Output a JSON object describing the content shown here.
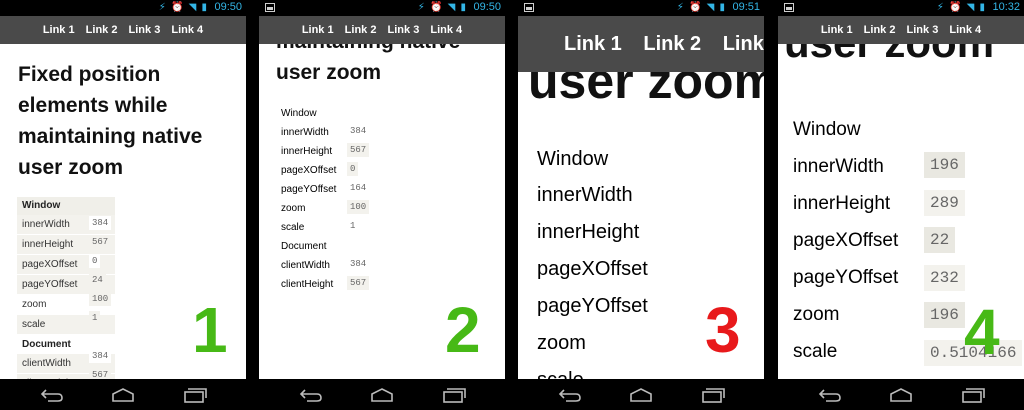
{
  "nav_links": [
    "Link 1",
    "Link 2",
    "Link 3",
    "Link 4"
  ],
  "headings": {
    "full": "Fixed position elements while maintaining native user zoom",
    "partial": "maintaining native user zoom",
    "zoomed": "user zoom",
    "clipped_line": "maintaining native"
  },
  "labels": {
    "window": "Window",
    "document": "Document",
    "innerWidth": "innerWidth",
    "innerHeight": "innerHeight",
    "pageXOffset": "pageXOffset",
    "pageYOffset": "pageYOffset",
    "zoom": "zoom",
    "scale": "scale",
    "clientWidth": "clientWidth",
    "clientHeight": "clientHeight"
  },
  "colors": {
    "green": "#47b916",
    "red": "#e8191b",
    "status_blue": "#33b5e5",
    "navbar": "#4a4a4a"
  },
  "phones": [
    {
      "time": "09:50",
      "number": "1",
      "number_color": "green",
      "values": {
        "innerWidth": "384",
        "innerHeight": "567",
        "pageXOffset": "0",
        "pageYOffset": "24",
        "zoom": "100",
        "scale": "1",
        "clientWidth": "384",
        "clientHeight": "567"
      }
    },
    {
      "time": "09:50",
      "number": "2",
      "number_color": "green",
      "values": {
        "innerWidth": "384",
        "innerHeight": "567",
        "pageXOffset": "0",
        "pageYOffset": "164",
        "zoom": "100",
        "scale": "1",
        "clientWidth": "384",
        "clientHeight": "567"
      }
    },
    {
      "time": "09:51",
      "number": "3",
      "number_color": "red",
      "values": {}
    },
    {
      "time": "10:32",
      "number": "4",
      "number_color": "green",
      "values": {
        "innerWidth": "196",
        "innerHeight": "289",
        "pageXOffset": "22",
        "pageYOffset": "232",
        "zoom": "196",
        "scale": "0.5104166"
      }
    }
  ],
  "icons": [
    "image-thumbnail-icon",
    "status-icons",
    "back-icon",
    "home-icon",
    "recents-icon"
  ]
}
